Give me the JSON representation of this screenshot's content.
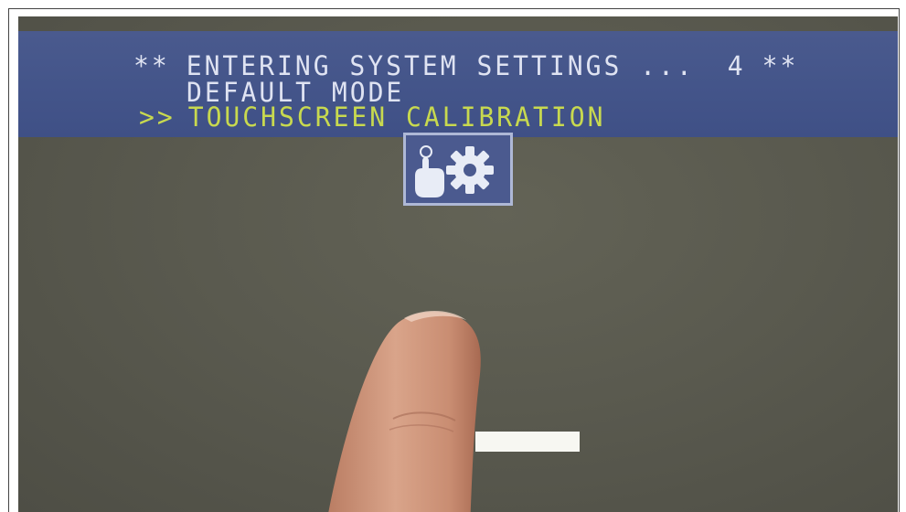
{
  "header": {
    "line1_prefix": "**",
    "line1_text": "ENTERING SYSTEM SETTINGS ...",
    "line1_countdown": "4",
    "line1_suffix": "**",
    "line2_text": "DEFAULT MODE",
    "line3_marker": ">>",
    "line3_text": "TOUCHSCREEN CALIBRATION"
  },
  "icons": {
    "settings_icon": "touch-gear-icon"
  },
  "colors": {
    "screen_bg": "#5a5a4f",
    "header_bg": "#44558a",
    "header_text": "#dfe3f2",
    "selected_text": "#c8d94f",
    "icon_border": "#aeb8d6",
    "calibration_bar": "#f7f7f2"
  }
}
